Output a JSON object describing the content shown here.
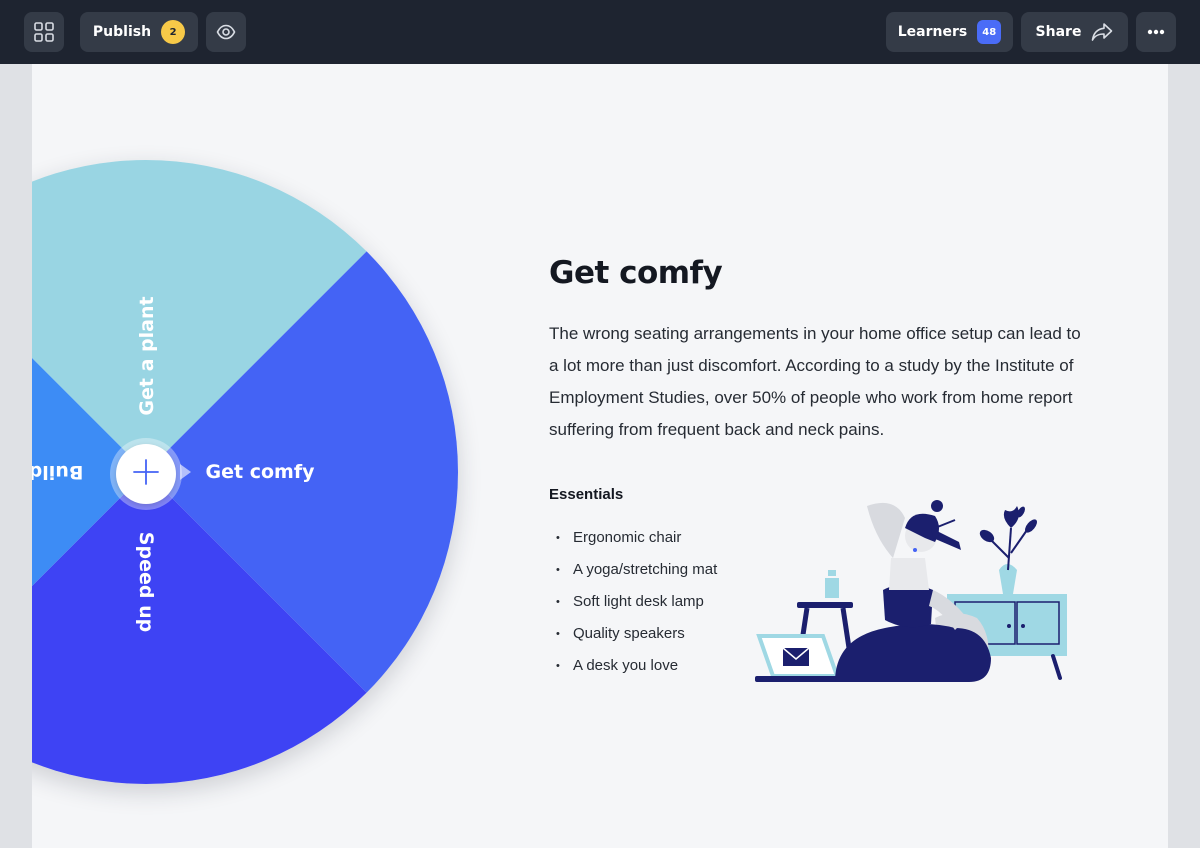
{
  "toolbar": {
    "publish_label": "Publish",
    "publish_count": "2",
    "learners_label": "Learners",
    "learners_count": "48",
    "share_label": "Share",
    "icons": {
      "apps": "grid-icon",
      "preview": "eye-icon",
      "share": "share-arrow-icon",
      "more": "more-dots-icon"
    }
  },
  "wheel": {
    "segments": [
      {
        "label": "Get a plant",
        "color": "#99d5e3"
      },
      {
        "label": "Get comfy",
        "color": "#4463f5",
        "active": true
      },
      {
        "label": "Speed up",
        "color": "#3e43f4"
      },
      {
        "label": "Build",
        "color": "#3d8cf5"
      }
    ],
    "center_icon": "plus-icon"
  },
  "content": {
    "title": "Get comfy",
    "body": "The wrong seating arrangements in your home office setup can lead to a lot more than just discomfort. According to a study by the Institute of Employment Studies, over 50% of people who work from home report suffering from frequent back and neck pains.",
    "essentials_label": "Essentials",
    "essentials": [
      "Ergonomic chair",
      "A yoga/stretching mat",
      "Soft light desk lamp",
      "Quality speakers",
      "A desk you love"
    ]
  },
  "colors": {
    "topbar": "#1e2430",
    "button": "#343b47",
    "canvas": "#f5f6f8",
    "navy": "#1b1f6e",
    "light_blue": "#99d5e3"
  }
}
